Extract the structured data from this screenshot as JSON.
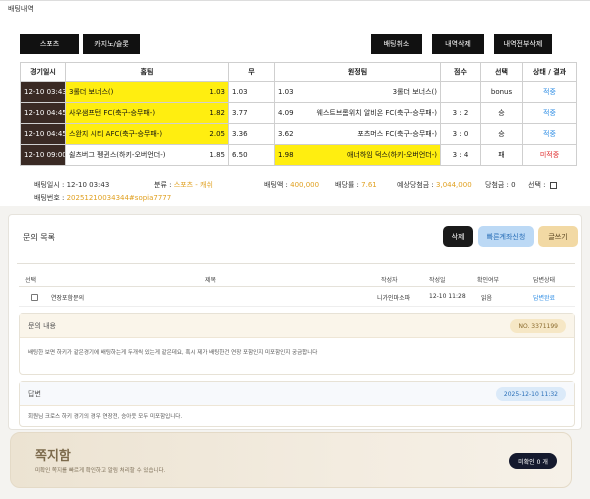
{
  "bet": {
    "title": "배팅내역",
    "buttons": {
      "sports": "스포츠",
      "casino": "카지노/슬롯",
      "cancel": "배팅취소",
      "delete": "내역삭제",
      "delete_all": "내역전부삭제"
    },
    "headers": [
      "경기일시",
      "홈팀",
      "무",
      "원정팀",
      "점수",
      "선택",
      "상태 / 결과"
    ],
    "rows": [
      {
        "time": "12-10 03:43",
        "home": "3롤더 보너스()",
        "home_odds": "1.03",
        "draw": "1.03",
        "away_odds": "1.03",
        "away": "3롤더 보너스()",
        "score": "",
        "pick": "bonus",
        "status": "적중",
        "home_hl": true,
        "away_hl": false,
        "status_color": "blue"
      },
      {
        "time": "12-10 04:45",
        "home": "사우샘프턴 FC(축구-승무패-)",
        "home_odds": "1.82",
        "draw": "3.77",
        "away_odds": "4.09",
        "away": "웨스트브롬위치 알비온 FC(축구-승무패-)",
        "score": "3 : 2",
        "pick": "승",
        "status": "적중",
        "home_hl": true,
        "away_hl": false,
        "status_color": "blue"
      },
      {
        "time": "12-10 04:45",
        "home": "스완지 시티 AFC(축구-승무패-)",
        "home_odds": "2.05",
        "draw": "3.36",
        "away_odds": "3.62",
        "away": "포츠머스 FC(축구-승무패-)",
        "score": "3 : 0",
        "pick": "승",
        "status": "적중",
        "home_hl": true,
        "away_hl": false,
        "status_color": "blue"
      },
      {
        "time": "12-10 09:00",
        "home": "쉴츠버그 펭귄스(하키-오버언더-)",
        "home_odds": "1.85",
        "draw": "6.50",
        "away_odds": "1.98",
        "away": "애너하임 덕스(하키-오버언더-)",
        "score": "3 : 4",
        "pick": "패",
        "status": "미적중",
        "home_hl": false,
        "away_hl": true,
        "status_color": "red"
      }
    ],
    "summary": {
      "time_label": "배팅일시 : 12-10 03:43",
      "category_label": "분류 : ",
      "category_value": "스포츠 - 캐쉬",
      "amount_label": "배팅액 : ",
      "amount_value": "400,000",
      "odds_label": "배당률 : ",
      "odds_value": "7.61",
      "expected_label": "예상당첨금 : ",
      "expected_value": "3,044,000",
      "win_label": "당첨금 : 0",
      "select_label": "선택 : ",
      "id_label": "배팅번호 : ",
      "id_value": "20251210034344#sopia7777"
    }
  },
  "inquiry": {
    "title": "문의 목록",
    "buttons": {
      "delete": "삭제",
      "quick": "빠른계좌신청",
      "write": "글쓰기"
    },
    "headers": {
      "select": "선택",
      "subject": "제목",
      "author": "작성자",
      "date": "작성일",
      "checked": "확인여부",
      "reply_status": "답변상태"
    },
    "row": {
      "subject": "연장포함문의",
      "author": "니가인마소파",
      "date": "12-10 11:28",
      "checked": "읽음",
      "reply_status": "답변완료"
    },
    "content_label": "문의 내용",
    "content_no": "NO. 3371199",
    "content_text": "배팅한 보면 하키가 같은경기에 배팅하는게 두개씩 있는게 같은데요, 혹시 제가 배팅한건 연장 포함인지 미포함인지 궁금합니다",
    "answer_label": "답변",
    "answer_date": "2025-12-10 11:32",
    "answer_text": "회원님 크로스 하키 경기의 경우 연장전, 승아웃 모두 미포함입니다."
  },
  "message": {
    "title": "쪽지함",
    "subtitle": "미확인 쪽지를 빠르게 확인하고 알림 처리할 수 있습니다.",
    "unread": "미확인 0 개"
  },
  "colors": {
    "highlight": "#ffee10",
    "time_bg": "#3a2a24",
    "win": "#2f8ee5",
    "lose": "#e03030",
    "quick_btn": "#bcd9f5",
    "write_btn": "#f2d9a4"
  }
}
